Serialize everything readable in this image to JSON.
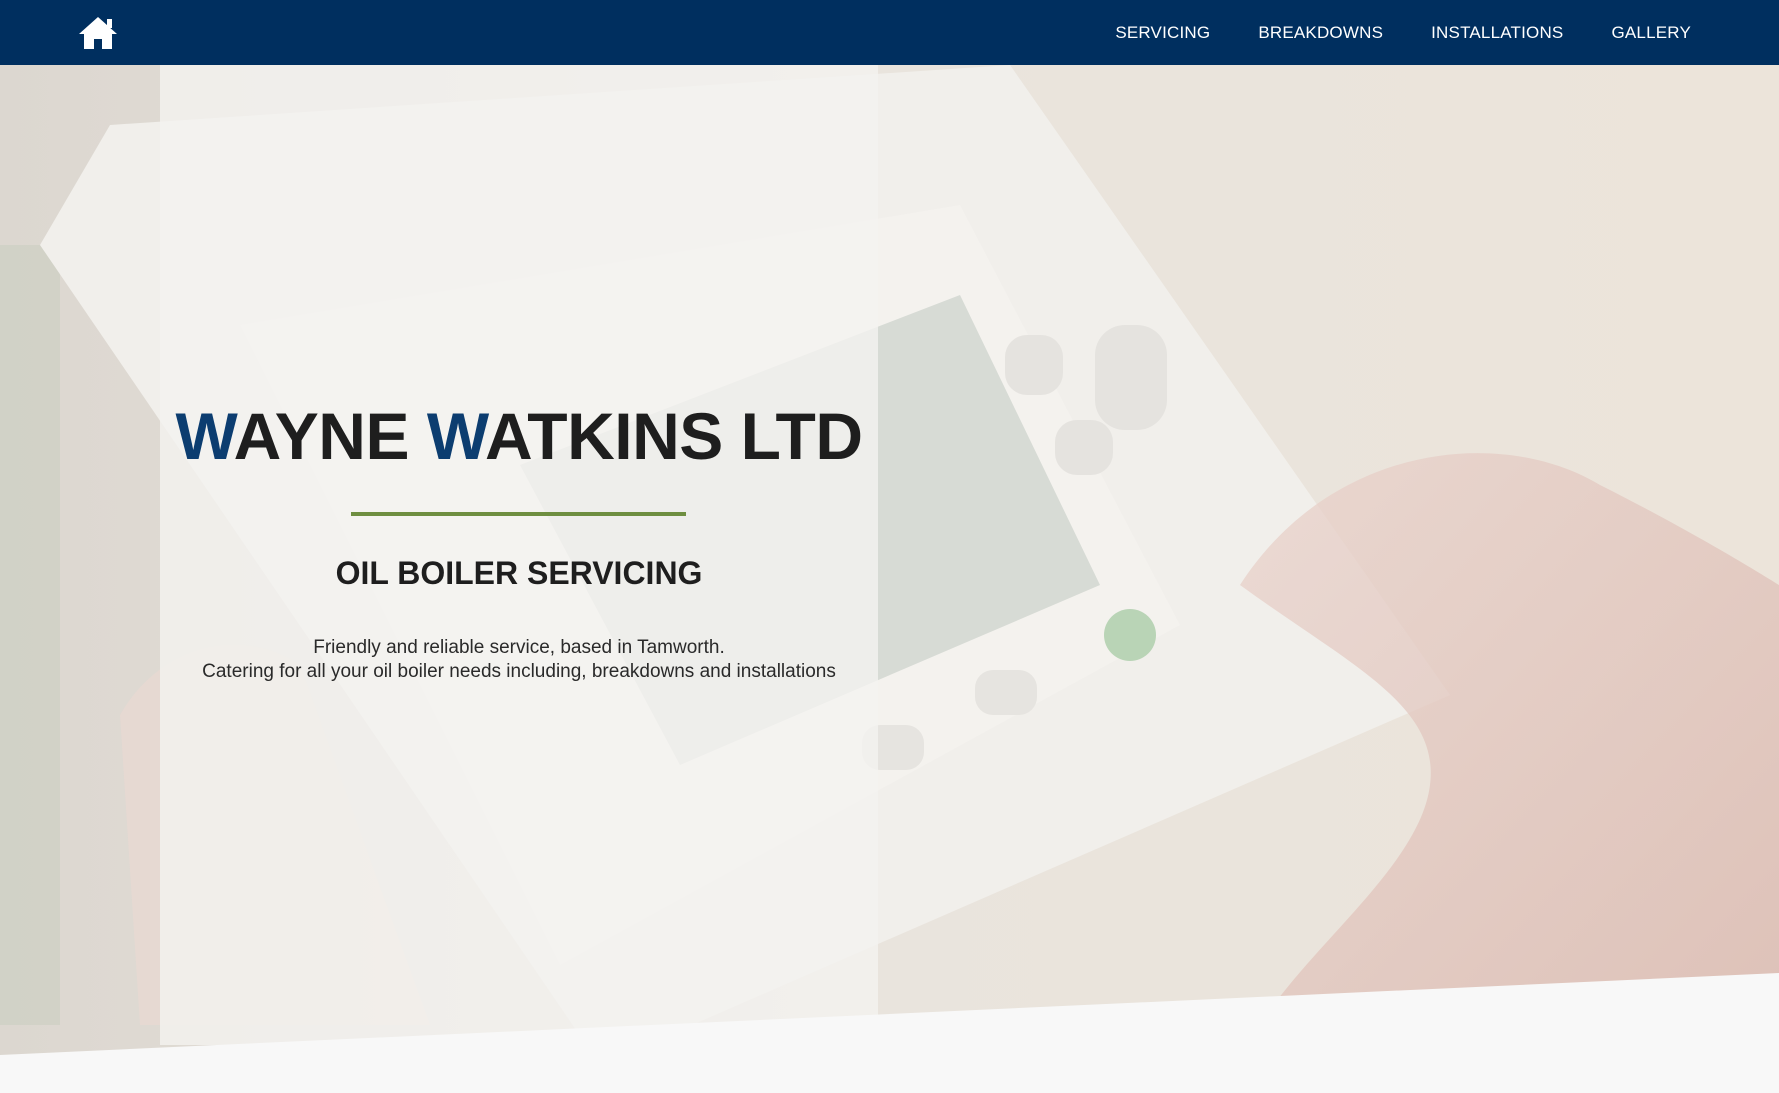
{
  "nav": {
    "home_icon": "home-icon",
    "links": [
      "SERVICING",
      "BREAKDOWNS",
      "INSTALLATIONS",
      "GALLERY"
    ]
  },
  "hero": {
    "title_first_initial": "W",
    "title_first_rest": "AYNE ",
    "title_second_initial": "W",
    "title_second_rest": "ATKINS LTD",
    "subtitle": "OIL BOILER SERVICING",
    "description_line1": "Friendly and reliable service, based in Tamworth.",
    "description_line2": "Catering for all your oil boiler needs including, breakdowns and installations"
  },
  "colors": {
    "navbar": "#002f5f",
    "accent_blue": "#0c3d70",
    "divider_green": "#6e8e40",
    "text_dark": "#1e1e1e"
  }
}
